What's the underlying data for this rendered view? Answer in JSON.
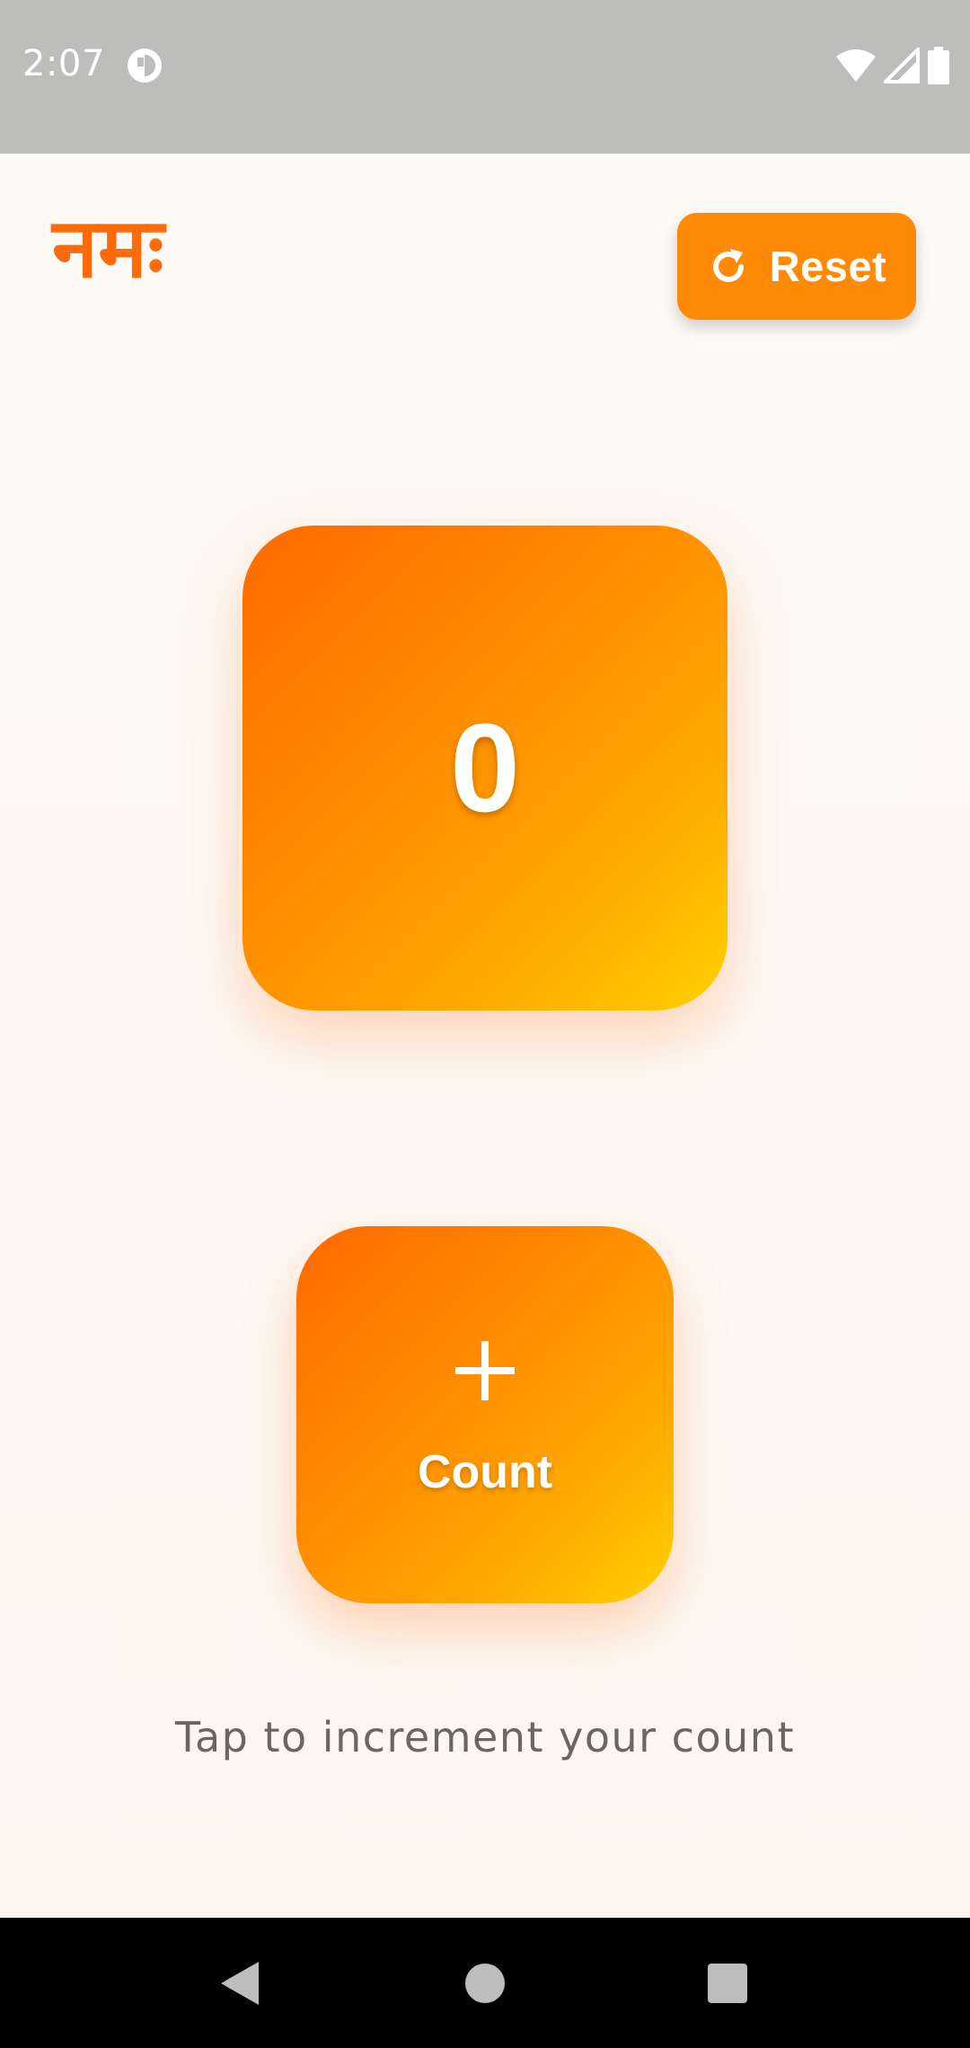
{
  "status_bar": {
    "time": "2:07",
    "icons": [
      "notification-icon",
      "wifi-icon",
      "cell-signal-icon",
      "battery-icon"
    ]
  },
  "header": {
    "logo_text": "नमः",
    "reset_label": "Reset",
    "reset_icon": "refresh-icon"
  },
  "counter": {
    "value": "0"
  },
  "count_button": {
    "icon": "plus-icon",
    "label": "Count"
  },
  "hint": "Tap to increment your count",
  "nav_bar": {
    "buttons": [
      "back",
      "home",
      "recents"
    ]
  },
  "colors": {
    "accent": "#ff6a0b",
    "button": "#ff8a05",
    "gradient_start": "#ff6a00",
    "gradient_end": "#ffd200",
    "background": "#fdf8f4",
    "status_bar": "#bdbdbb"
  }
}
